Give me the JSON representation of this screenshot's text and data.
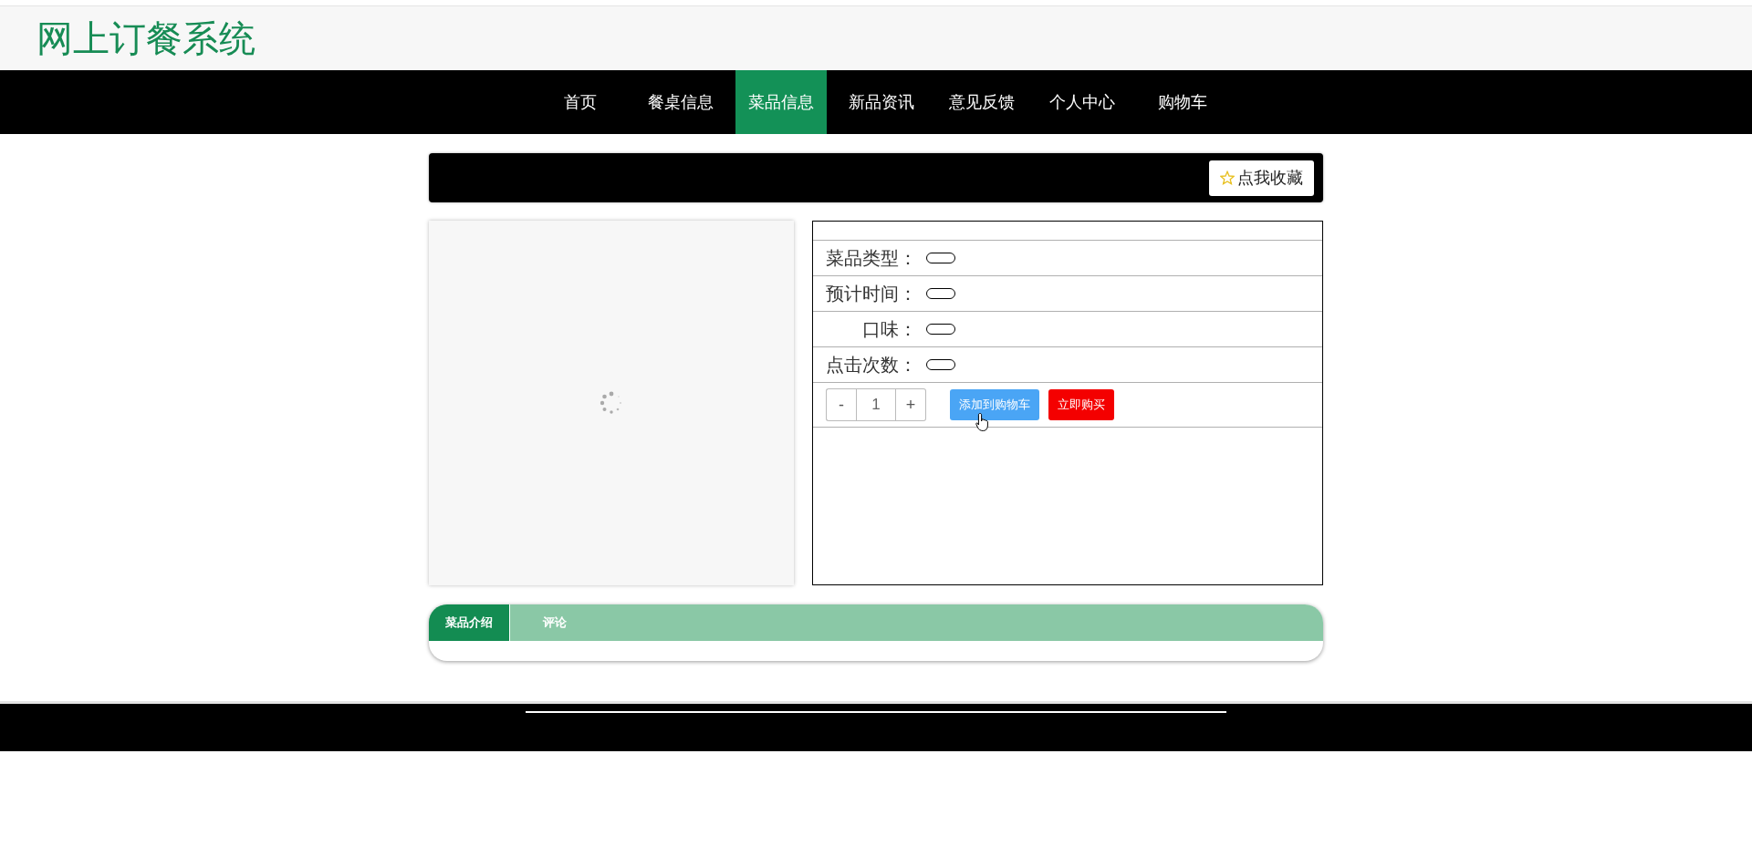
{
  "header": {
    "title": "网上订餐系统"
  },
  "nav": [
    {
      "label": "首页",
      "selected": false
    },
    {
      "label": "餐桌信息",
      "selected": false
    },
    {
      "label": "菜品信息",
      "selected": true
    },
    {
      "label": "新品资讯",
      "selected": false
    },
    {
      "label": "意见反馈",
      "selected": false
    },
    {
      "label": "个人中心",
      "selected": false
    },
    {
      "label": "购物车",
      "selected": false
    }
  ],
  "top_bar": {
    "favorite_button": "点我收藏"
  },
  "details": {
    "rows": [
      {
        "label": "菜品类型："
      },
      {
        "label": "预计时间："
      },
      {
        "label": "口味："
      },
      {
        "label": "点击次数："
      }
    ],
    "quantity": {
      "minus": "-",
      "value": "1",
      "plus": "+"
    },
    "add_to_cart": "添加到购物车",
    "buy_now": "立即购买"
  },
  "tabs": [
    {
      "label": "菜品介绍",
      "selected": true
    },
    {
      "label": "评论",
      "selected": false
    }
  ]
}
